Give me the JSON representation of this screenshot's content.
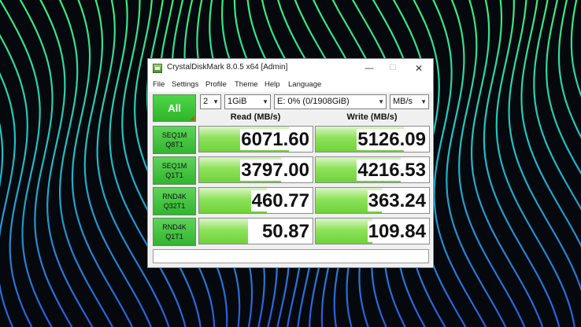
{
  "window": {
    "title": "CrystalDiskMark 8.0.5 x64 [Admin]"
  },
  "controls": {
    "minimize": "—",
    "maximize": "☐",
    "close": "✕"
  },
  "menu": [
    "File",
    "Settings",
    "Profile",
    "Theme",
    "Help",
    "Language"
  ],
  "toolbar": {
    "all_label": "All",
    "count": "2",
    "size": "1GiB",
    "drive": "E: 0% (0/1908GiB)",
    "unit": "MB/s"
  },
  "headers": {
    "read": "Read (MB/s)",
    "write": "Write (MB/s)"
  },
  "rows": [
    {
      "line1": "SEQ1M",
      "line2": "Q8T1",
      "read": "6071.60",
      "write": "5126.09",
      "read_fill": 0.79,
      "write_fill": 0.78
    },
    {
      "line1": "SEQ1M",
      "line2": "Q1T1",
      "read": "3797.00",
      "write": "4216.53",
      "read_fill": 0.72,
      "write_fill": 0.75
    },
    {
      "line1": "RND4K",
      "line2": "Q32T1",
      "read": "460.77",
      "write": "363.24",
      "read_fill": 0.6,
      "write_fill": 0.58
    },
    {
      "line1": "RND4K",
      "line2": "Q1T1",
      "read": "50.87",
      "write": "109.84",
      "read_fill": 0.43,
      "write_fill": 0.5
    }
  ],
  "comment": ""
}
